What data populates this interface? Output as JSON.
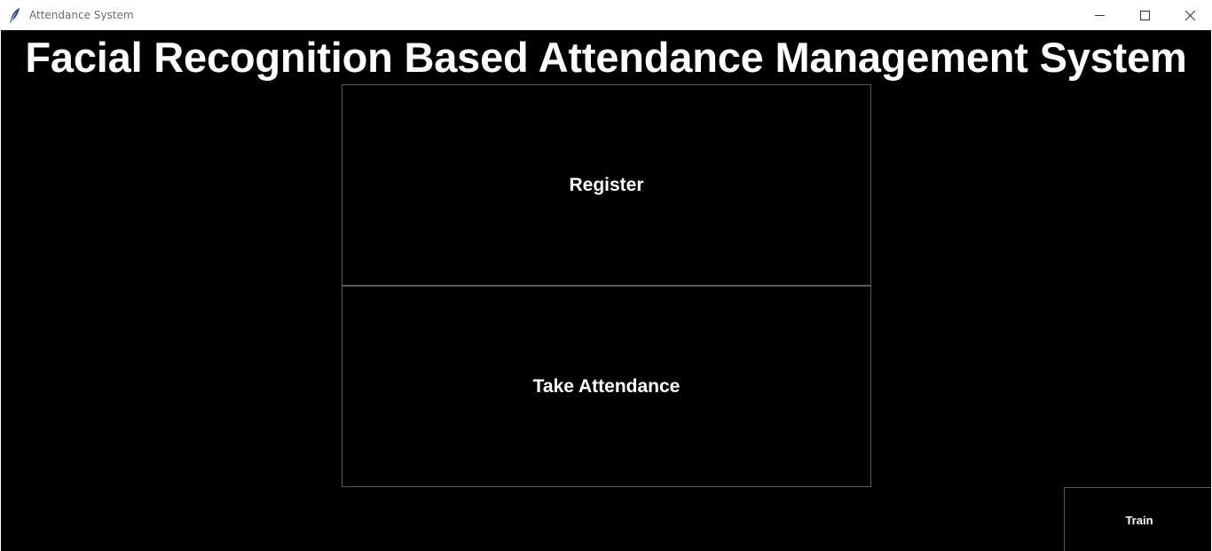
{
  "window": {
    "title": "Attendance System",
    "controls": {
      "minimize_icon": "minimize-icon",
      "maximize_icon": "maximize-icon",
      "close_icon": "close-icon"
    }
  },
  "main": {
    "heading": "Facial Recognition Based Attendance Management System",
    "buttons": {
      "register": "Register",
      "take_attendance": "Take Attendance",
      "train": "Train"
    }
  },
  "colors": {
    "background": "#000000",
    "text": "#ffffff",
    "button_border": "#5a5a5a",
    "titlebar": "#ffffff"
  }
}
